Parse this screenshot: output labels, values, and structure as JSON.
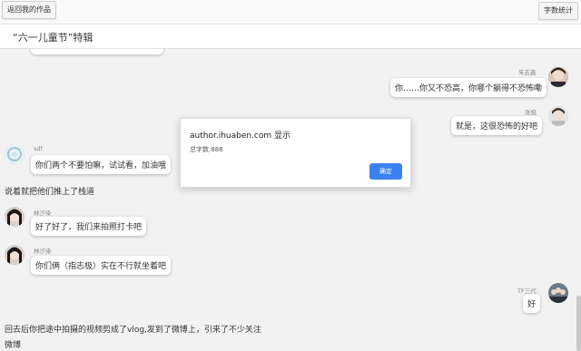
{
  "toolbar": {
    "back_label": "返回我的作品",
    "count_label": "字数统计"
  },
  "page": {
    "title": "“六一儿童节”特辑"
  },
  "messages": [
    {
      "speaker": "",
      "text": "",
      "side": "left"
    },
    {
      "speaker": "朱志鑫",
      "text": "你……你又不恐高，你哪个躺得不恐怖嘞",
      "side": "right"
    },
    {
      "speaker": "张极",
      "text": "就是，这很恐怖的好吧",
      "side": "right"
    },
    {
      "speaker": "sdf",
      "text": "你们两个不要怕嘛，试试看，加油哦",
      "side": "left"
    },
    {
      "narration": "说着就把他们推上了栈道"
    },
    {
      "speaker": "林汐染",
      "text": "好了好了，我们来拍照打卡吧",
      "side": "left"
    },
    {
      "speaker": "林汐染",
      "text": "你们俩（指志极）实在不行就坐着吧",
      "side": "left"
    },
    {
      "speaker": "TF三代",
      "text": "好",
      "side": "right"
    },
    {
      "narration": "回去后你把途中拍摄的视频剪成了vlog,发到了微博上，引来了不少关注"
    },
    {
      "narration": "微博"
    }
  ],
  "dialog": {
    "title": "author.ihuaben.com 显示",
    "message": "总字数:888",
    "ok_label": "确定"
  }
}
